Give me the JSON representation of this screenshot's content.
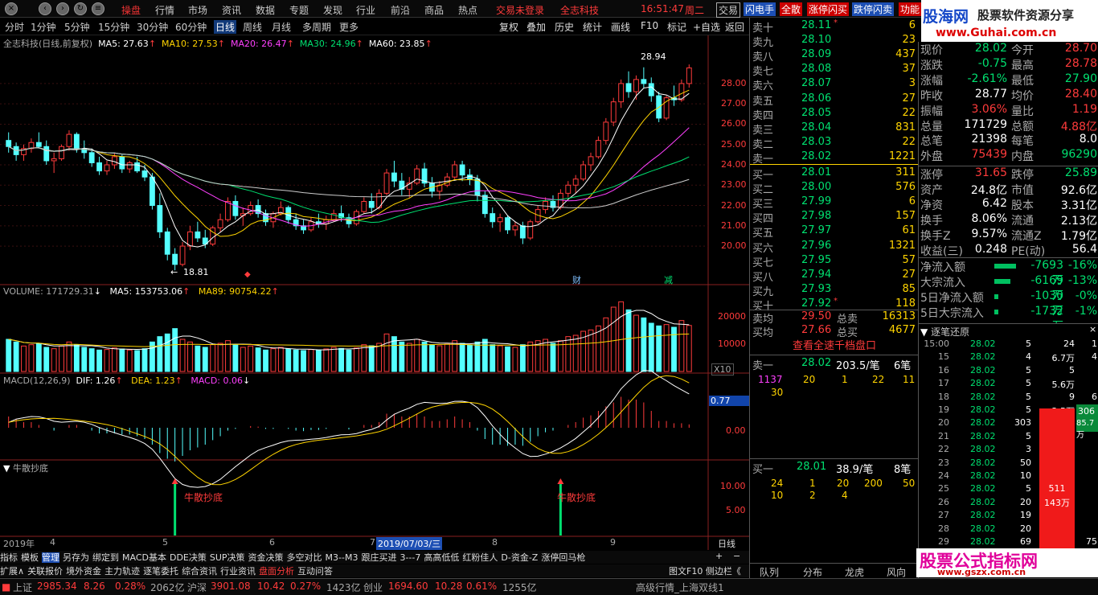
{
  "window": {
    "menu": [
      "操盘",
      "行情",
      "市场",
      "资讯",
      "数据",
      "专题",
      "发现",
      "行业",
      "前沿",
      "商品",
      "热点"
    ],
    "trade_notice": "交易未登录",
    "stock_title": "全志科技",
    "time": "16:51:47",
    "weekday": "周二",
    "right_buttons": [
      "交易",
      "闪电手",
      "全散",
      "涨停闪买",
      "跌停闪卖",
      "功能"
    ]
  },
  "ad_top": {
    "logo": "股海网",
    "tagline": "股票软件资源分享",
    "url": "www.Guhai.com.cn"
  },
  "ad_bottom": {
    "text": "股票公式指标网",
    "url": "www.gszx.com.cn"
  },
  "periods": [
    "分时",
    "1分钟",
    "5分钟",
    "15分钟",
    "30分钟",
    "60分钟",
    "日线",
    "周线",
    "月线",
    "多周期",
    "更多"
  ],
  "tools": [
    "复权",
    "叠加",
    "历史",
    "统计",
    "画线",
    "F10",
    "标记",
    "+自选",
    "返回"
  ],
  "kline_header": {
    "title": "全志科技(日线,前复权)",
    "ma5": "MA5: 27.63",
    "ma10": "MA10: 27.53",
    "ma20": "MA20: 26.47",
    "ma30": "MA30: 24.96",
    "ma60": "MA60: 23.85"
  },
  "kline_axis": [
    "28.00",
    "27.00",
    "26.00",
    "25.00",
    "24.00",
    "23.00",
    "22.00",
    "21.00",
    "20.00"
  ],
  "kline_annot": {
    "high": "28.94",
    "low": "18.81",
    "cai": "财",
    "jian": "减"
  },
  "volume_header": {
    "label": "VOLUME: 171729.31",
    "ma5": "MA5: 153753.06",
    "ma89": "MA89: 90754.22"
  },
  "volume_axis": [
    "20000",
    "10000"
  ],
  "volume_unit": "X10",
  "macd_header": {
    "label": "MACD(12,26,9)",
    "dif": "DIF: 1.26",
    "dea": "DEA: 1.23",
    "macd": "MACD: 0.06"
  },
  "macd_axis": {
    "cur": "0.77",
    "zero": "0.00"
  },
  "niu_header": "牛散抄底",
  "niu_label": "牛散抄底",
  "niu_axis": [
    "10.00",
    "5.00"
  ],
  "date_axis": {
    "year": "2019年",
    "m4": "4",
    "m5": "5",
    "m6": "6",
    "m7": "7",
    "sel": "2019/07/03/三",
    "m8": "8",
    "m9": "9",
    "period": "日线"
  },
  "tabs1": [
    "指标",
    "模板",
    "管理",
    "另存为",
    "绑定到",
    "MACD基本",
    "DDE决策",
    "SUP决策",
    "资金决策",
    "多空对比",
    "M3--M3",
    "跟庄买进",
    "3---7",
    "高高低低",
    "红粉佳人",
    "D-资金-Z",
    "涨停回马枪"
  ],
  "tabs2": [
    "扩展∧",
    "关联报价",
    "境外资金",
    "主力轨迹",
    "逐笔委托",
    "综合资讯",
    "行业资讯",
    "盘面分析",
    "互动问答"
  ],
  "tabs2_right": "图文F10 侧边栏《",
  "order_book": {
    "sells": [
      {
        "label": "卖十",
        "price": "28.11",
        "vol": "6",
        "mark": "*"
      },
      {
        "label": "卖九",
        "price": "28.10",
        "vol": "23",
        "mark": ""
      },
      {
        "label": "卖八",
        "price": "28.09",
        "vol": "437",
        "mark": ""
      },
      {
        "label": "卖七",
        "price": "28.08",
        "vol": "37",
        "mark": ""
      },
      {
        "label": "卖六",
        "price": "28.07",
        "vol": "3",
        "mark": ""
      },
      {
        "label": "卖五",
        "price": "28.06",
        "vol": "27",
        "mark": ""
      },
      {
        "label": "卖四",
        "price": "28.05",
        "vol": "22",
        "mark": ""
      },
      {
        "label": "卖三",
        "price": "28.04",
        "vol": "831",
        "mark": ""
      },
      {
        "label": "卖二",
        "price": "28.03",
        "vol": "22",
        "mark": ""
      },
      {
        "label": "卖一",
        "price": "28.02",
        "vol": "1221",
        "mark": ""
      }
    ],
    "buys": [
      {
        "label": "买一",
        "price": "28.01",
        "vol": "311",
        "mark": ""
      },
      {
        "label": "买二",
        "price": "28.00",
        "vol": "576",
        "mark": ""
      },
      {
        "label": "买三",
        "price": "27.99",
        "vol": "6",
        "mark": ""
      },
      {
        "label": "买四",
        "price": "27.98",
        "vol": "157",
        "mark": ""
      },
      {
        "label": "买五",
        "price": "27.97",
        "vol": "61",
        "mark": ""
      },
      {
        "label": "买六",
        "price": "27.96",
        "vol": "1321",
        "mark": ""
      },
      {
        "label": "买七",
        "price": "27.95",
        "vol": "57",
        "mark": ""
      },
      {
        "label": "买八",
        "price": "27.94",
        "vol": "27",
        "mark": ""
      },
      {
        "label": "买九",
        "price": "27.93",
        "vol": "85",
        "mark": ""
      },
      {
        "label": "买十",
        "price": "27.92",
        "vol": "118",
        "mark": "*"
      }
    ],
    "avg_sell": {
      "label": "卖均",
      "price": "29.50",
      "tlabel": "总卖",
      "tval": "16313"
    },
    "avg_buy": {
      "label": "买均",
      "price": "27.66",
      "tlabel": "总买",
      "tval": "4677"
    },
    "full_btn": "查看全速千档盘口",
    "sell1": {
      "label": "卖一",
      "price": "28.02",
      "amt": "203.5/笔",
      "cnt": "6笔",
      "queue": [
        "1137",
        "20",
        "1",
        "22",
        "11",
        "30"
      ]
    },
    "buy1": {
      "label": "买一",
      "price": "28.01",
      "amt": "38.9/笔",
      "cnt": "8笔",
      "queue": [
        "24",
        "1",
        "20",
        "200",
        "50",
        "10",
        "2",
        "4"
      ]
    }
  },
  "quote": {
    "rows": [
      [
        "现价",
        "28.02",
        "今开",
        "28.70"
      ],
      [
        "涨跌",
        "-0.75",
        "最高",
        "28.78"
      ],
      [
        "涨幅",
        "-2.61%",
        "最低",
        "27.90"
      ],
      [
        "昨收",
        "28.77",
        "均价",
        "28.40"
      ],
      [
        "振幅",
        "3.06%",
        "量比",
        "1.19"
      ],
      [
        "总量",
        "171729",
        "总额",
        "4.88亿"
      ],
      [
        "总笔",
        "21398",
        "每笔",
        "8.0"
      ],
      [
        "外盘",
        "75439",
        "内盘",
        "96290"
      ],
      [
        "涨停",
        "31.65",
        "跌停",
        "25.89"
      ],
      [
        "资产",
        "24.8亿",
        "市值",
        "92.6亿"
      ],
      [
        "净资",
        "6.42",
        "股本",
        "3.31亿"
      ],
      [
        "换手",
        "8.06%",
        "流通",
        "2.13亿"
      ],
      [
        "换手Z",
        "9.57%",
        "流通Z",
        "1.79亿"
      ],
      [
        "收益(三)",
        "0.248",
        "PE(动)",
        "56.4"
      ]
    ],
    "flows": [
      {
        "label": "净流入额",
        "val": "-7693万",
        "pct": "-16%",
        "bar": 0.3
      },
      {
        "label": "大宗流入",
        "val": "-6169万",
        "pct": "-13%",
        "bar": 0.22
      },
      {
        "label": "5日净流入额",
        "val": "-1030万",
        "pct": "-0%",
        "bar": 0.05
      },
      {
        "label": "5日大宗流入",
        "val": "-1732万",
        "pct": "-1%",
        "bar": 0.05
      }
    ]
  },
  "ticks": {
    "title": "逐笔还原",
    "rows": [
      [
        "15:00",
        "28.02",
        "5",
        "24"
      ],
      [
        "15",
        "28.02",
        "4",
        "6.7万"
      ],
      [
        "16",
        "28.02",
        "5",
        "5"
      ],
      [
        "17",
        "28.02",
        "5",
        "5.6万"
      ],
      [
        "18",
        "28.02",
        "5",
        "9"
      ],
      [
        "19",
        "28.02",
        "5",
        "2.5万"
      ],
      [
        "20",
        "28.02",
        "303",
        ""
      ],
      [
        "21",
        "28.02",
        "5",
        ""
      ],
      [
        "22",
        "28.02",
        "3",
        ""
      ],
      [
        "23",
        "28.02",
        "50",
        ""
      ],
      [
        "24",
        "28.02",
        "10",
        ""
      ],
      [
        "25",
        "28.02",
        "5",
        "511"
      ],
      [
        "26",
        "28.02",
        "20",
        ""
      ],
      [
        "27",
        "28.02",
        "19",
        ""
      ],
      [
        "28",
        "28.02",
        "20",
        ""
      ],
      [
        "29",
        "28.02",
        "69",
        ""
      ]
    ],
    "right_col": [
      "1",
      "4",
      "",
      "",
      "6",
      "",
      "",
      "",
      "",
      "",
      "",
      "",
      "",
      "",
      "",
      "75"
    ],
    "bar_labels": [
      "511",
      "143万"
    ],
    "side_green": [
      "306",
      "85.7万"
    ]
  },
  "bottom_tabs": [
    "队列",
    "分布",
    "龙虎",
    "风向"
  ],
  "status": {
    "items": [
      {
        "name": "上证",
        "val": "2985.34",
        "chg": "8.26",
        "pct": "0.28%",
        "amt": "2062亿"
      },
      {
        "name": "沪深",
        "val": "3901.08",
        "chg": "10.42",
        "pct": "0.27%",
        "amt": "1423亿"
      },
      {
        "name": "创业",
        "val": "1694.60",
        "chg": "10.28",
        "pct": "0.61%",
        "amt": "1255亿"
      }
    ],
    "right": "高级行情_上海双线1"
  },
  "chart_data": {
    "type": "candlestick",
    "title": "全志科技(日线,前复权)",
    "ylim": [
      18.5,
      29.5
    ],
    "candles": [
      [
        25.2,
        25.6,
        24.6,
        24.9
      ],
      [
        24.9,
        25.1,
        24.2,
        24.5
      ],
      [
        24.5,
        25.0,
        24.2,
        24.8
      ],
      [
        24.8,
        25.3,
        24.6,
        25.1
      ],
      [
        25.1,
        25.6,
        24.8,
        24.9
      ],
      [
        24.9,
        25.2,
        24.0,
        24.2
      ],
      [
        24.2,
        24.6,
        23.6,
        24.3
      ],
      [
        24.3,
        25.0,
        24.2,
        24.9
      ],
      [
        24.9,
        25.7,
        24.7,
        25.5
      ],
      [
        25.5,
        25.6,
        24.6,
        24.8
      ],
      [
        24.8,
        25.2,
        24.3,
        24.6
      ],
      [
        24.6,
        24.8,
        23.9,
        24.1
      ],
      [
        24.1,
        24.4,
        23.5,
        23.7
      ],
      [
        23.7,
        24.2,
        23.5,
        24.0
      ],
      [
        24.0,
        24.6,
        23.8,
        24.4
      ],
      [
        24.4,
        24.5,
        23.6,
        23.8
      ],
      [
        23.8,
        24.2,
        23.6,
        24.1
      ],
      [
        24.1,
        24.4,
        23.6,
        23.7
      ],
      [
        23.7,
        24.0,
        23.2,
        23.4
      ],
      [
        23.4,
        23.6,
        21.8,
        22.0
      ],
      [
        22.0,
        22.6,
        20.4,
        20.7
      ],
      [
        20.7,
        20.9,
        19.3,
        19.6
      ],
      [
        19.6,
        19.9,
        18.81,
        19.1
      ],
      [
        19.1,
        20.2,
        19.0,
        20.0
      ],
      [
        20.0,
        21.0,
        19.8,
        20.7
      ],
      [
        20.7,
        21.2,
        20.2,
        20.4
      ],
      [
        20.4,
        20.8,
        19.9,
        20.1
      ],
      [
        20.1,
        21.0,
        20.0,
        20.9
      ],
      [
        20.9,
        21.6,
        20.7,
        21.3
      ],
      [
        21.3,
        22.4,
        21.2,
        22.2
      ],
      [
        22.2,
        22.5,
        21.3,
        21.5
      ],
      [
        21.5,
        21.9,
        21.0,
        21.6
      ],
      [
        21.6,
        22.2,
        21.5,
        22.0
      ],
      [
        22.0,
        22.3,
        21.4,
        21.6
      ],
      [
        21.6,
        21.8,
        21.0,
        21.2
      ],
      [
        21.2,
        21.7,
        20.9,
        21.6
      ],
      [
        21.6,
        22.2,
        21.5,
        21.9
      ],
      [
        21.9,
        22.0,
        21.1,
        21.3
      ],
      [
        21.3,
        21.6,
        20.8,
        21.0
      ],
      [
        21.0,
        21.3,
        20.6,
        20.8
      ],
      [
        20.8,
        21.4,
        20.7,
        21.2
      ],
      [
        21.2,
        21.6,
        20.9,
        21.1
      ],
      [
        21.1,
        21.5,
        20.8,
        21.3
      ],
      [
        21.3,
        21.8,
        21.2,
        21.6
      ],
      [
        21.6,
        22.0,
        21.2,
        21.4
      ],
      [
        21.4,
        21.6,
        20.9,
        21.1
      ],
      [
        21.1,
        21.8,
        21.0,
        21.7
      ],
      [
        21.7,
        22.4,
        21.6,
        22.2
      ],
      [
        22.2,
        22.6,
        21.6,
        21.9
      ],
      [
        21.9,
        22.8,
        21.8,
        22.6
      ],
      [
        22.6,
        23.8,
        22.5,
        23.6
      ],
      [
        23.6,
        24.2,
        22.9,
        23.2
      ],
      [
        23.2,
        23.6,
        22.5,
        22.8
      ],
      [
        22.8,
        23.4,
        22.4,
        23.1
      ],
      [
        23.1,
        24.0,
        23.0,
        23.8
      ],
      [
        23.8,
        24.1,
        22.9,
        23.1
      ],
      [
        23.1,
        23.4,
        22.4,
        22.7
      ],
      [
        22.7,
        23.2,
        22.3,
        23.0
      ],
      [
        23.0,
        23.6,
        22.9,
        23.4
      ],
      [
        23.4,
        24.2,
        23.3,
        24.0
      ],
      [
        24.0,
        24.2,
        23.2,
        23.5
      ],
      [
        23.5,
        23.8,
        23.0,
        23.3
      ],
      [
        23.3,
        23.5,
        22.2,
        22.5
      ],
      [
        22.5,
        22.7,
        21.4,
        21.6
      ],
      [
        21.6,
        21.9,
        20.9,
        21.2
      ],
      [
        21.2,
        21.6,
        20.7,
        21.4
      ],
      [
        21.4,
        21.5,
        20.6,
        20.8
      ],
      [
        20.8,
        21.2,
        20.5,
        21.0
      ],
      [
        21.0,
        21.2,
        20.1,
        20.4
      ],
      [
        20.4,
        21.3,
        20.3,
        21.2
      ],
      [
        21.2,
        22.0,
        21.1,
        21.8
      ],
      [
        21.8,
        22.4,
        21.6,
        22.2
      ],
      [
        22.2,
        22.5,
        21.7,
        21.9
      ],
      [
        21.9,
        22.8,
        21.8,
        22.6
      ],
      [
        22.6,
        23.2,
        22.4,
        23.0
      ],
      [
        23.0,
        23.5,
        22.6,
        23.3
      ],
      [
        23.3,
        24.2,
        23.2,
        24.0
      ],
      [
        24.0,
        24.6,
        23.7,
        24.4
      ],
      [
        24.4,
        25.4,
        24.3,
        25.2
      ],
      [
        25.2,
        26.3,
        25.0,
        26.1
      ],
      [
        26.1,
        27.3,
        25.9,
        27.1
      ],
      [
        27.1,
        28.2,
        26.8,
        28.0
      ],
      [
        28.0,
        28.6,
        27.3,
        27.6
      ],
      [
        27.6,
        28.4,
        27.2,
        28.2
      ],
      [
        28.2,
        28.8,
        27.8,
        28.0
      ],
      [
        28.0,
        28.3,
        27.1,
        27.4
      ],
      [
        27.4,
        27.6,
        26.1,
        26.3
      ],
      [
        26.3,
        27.4,
        26.2,
        27.3
      ],
      [
        27.3,
        27.9,
        26.9,
        27.2
      ],
      [
        27.2,
        28.2,
        27.1,
        28.0
      ],
      [
        28.0,
        28.94,
        27.8,
        28.77
      ]
    ],
    "volume": [
      120,
      110,
      95,
      100,
      105,
      90,
      85,
      95,
      110,
      100,
      90,
      85,
      80,
      82,
      88,
      84,
      80,
      78,
      85,
      110,
      130,
      140,
      160,
      120,
      110,
      95,
      90,
      100,
      105,
      115,
      100,
      90,
      95,
      88,
      80,
      85,
      90,
      84,
      80,
      78,
      82,
      80,
      84,
      90,
      86,
      80,
      88,
      100,
      96,
      105,
      140,
      130,
      110,
      105,
      120,
      110,
      100,
      96,
      102,
      115,
      105,
      98,
      110,
      120,
      100,
      96,
      92,
      90,
      100,
      110,
      115,
      120,
      105,
      115,
      130,
      135,
      150,
      155,
      170,
      200,
      240,
      260,
      230,
      210,
      200,
      180,
      170,
      175,
      165,
      190,
      171.7
    ],
    "macd": [
      0.2,
      0.15,
      0.1,
      0.1,
      0.05,
      0.0,
      -0.05,
      0.0,
      0.05,
      0.05,
      0.0,
      -0.05,
      -0.1,
      -0.1,
      -0.1,
      -0.12,
      -0.12,
      -0.15,
      -0.2,
      -0.3,
      -0.45,
      -0.55,
      -0.6,
      -0.5,
      -0.4,
      -0.35,
      -0.3,
      -0.22,
      -0.15,
      -0.05,
      -0.02,
      0.0,
      0.03,
      0.02,
      -0.02,
      -0.02,
      0.0,
      -0.02,
      -0.05,
      -0.06,
      -0.04,
      -0.04,
      -0.02,
      0.0,
      0.0,
      -0.03,
      0.0,
      0.05,
      0.05,
      0.1,
      0.25,
      0.25,
      0.2,
      0.2,
      0.25,
      0.2,
      0.12,
      0.12,
      0.15,
      0.2,
      0.15,
      0.1,
      -0.05,
      -0.2,
      -0.3,
      -0.3,
      -0.32,
      -0.3,
      -0.32,
      -0.25,
      -0.15,
      -0.08,
      -0.05,
      0.0,
      0.05,
      0.1,
      0.18,
      0.22,
      0.3,
      0.38,
      0.45,
      0.55,
      0.5,
      0.5,
      0.45,
      0.3,
      0.12,
      0.12,
      0.08,
      0.08,
      0.06
    ]
  }
}
